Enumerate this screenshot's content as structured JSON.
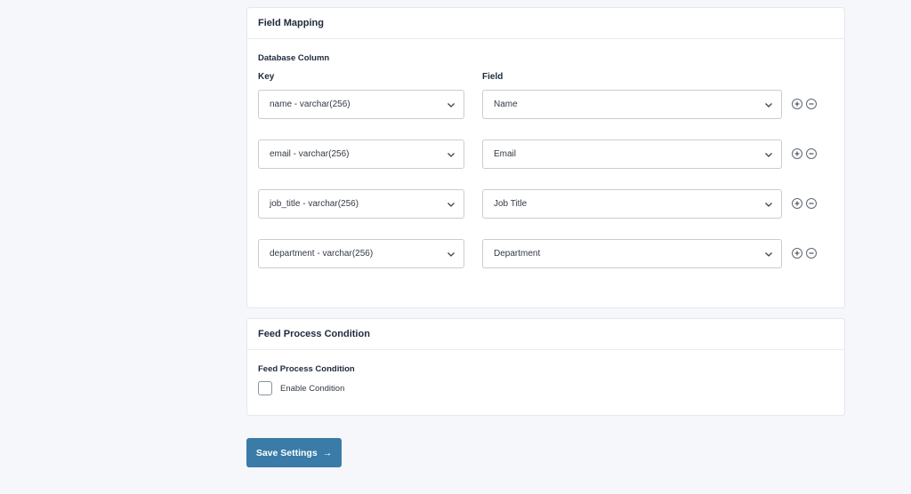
{
  "field_mapping": {
    "title": "Field Mapping",
    "section_label": "Database Column",
    "key_header": "Key",
    "field_header": "Field",
    "rows": [
      {
        "key": "name - varchar(256)",
        "field": "Name"
      },
      {
        "key": "email - varchar(256)",
        "field": "Email"
      },
      {
        "key": "job_title - varchar(256)",
        "field": "Job Title"
      },
      {
        "key": "department - varchar(256)",
        "field": "Department"
      }
    ],
    "icons": {
      "dropdown": "chevron-down-icon",
      "add": "plus-circle-icon",
      "remove": "minus-circle-icon"
    }
  },
  "feed_condition": {
    "title": "Feed Process Condition",
    "section_label": "Feed Process Condition",
    "checkbox_label": "Enable Condition",
    "checked": false
  },
  "actions": {
    "save_label": "Save Settings",
    "save_arrow": "→"
  },
  "colors": {
    "background": "#f5f7fa",
    "primary_button": "#3a7ba8"
  }
}
